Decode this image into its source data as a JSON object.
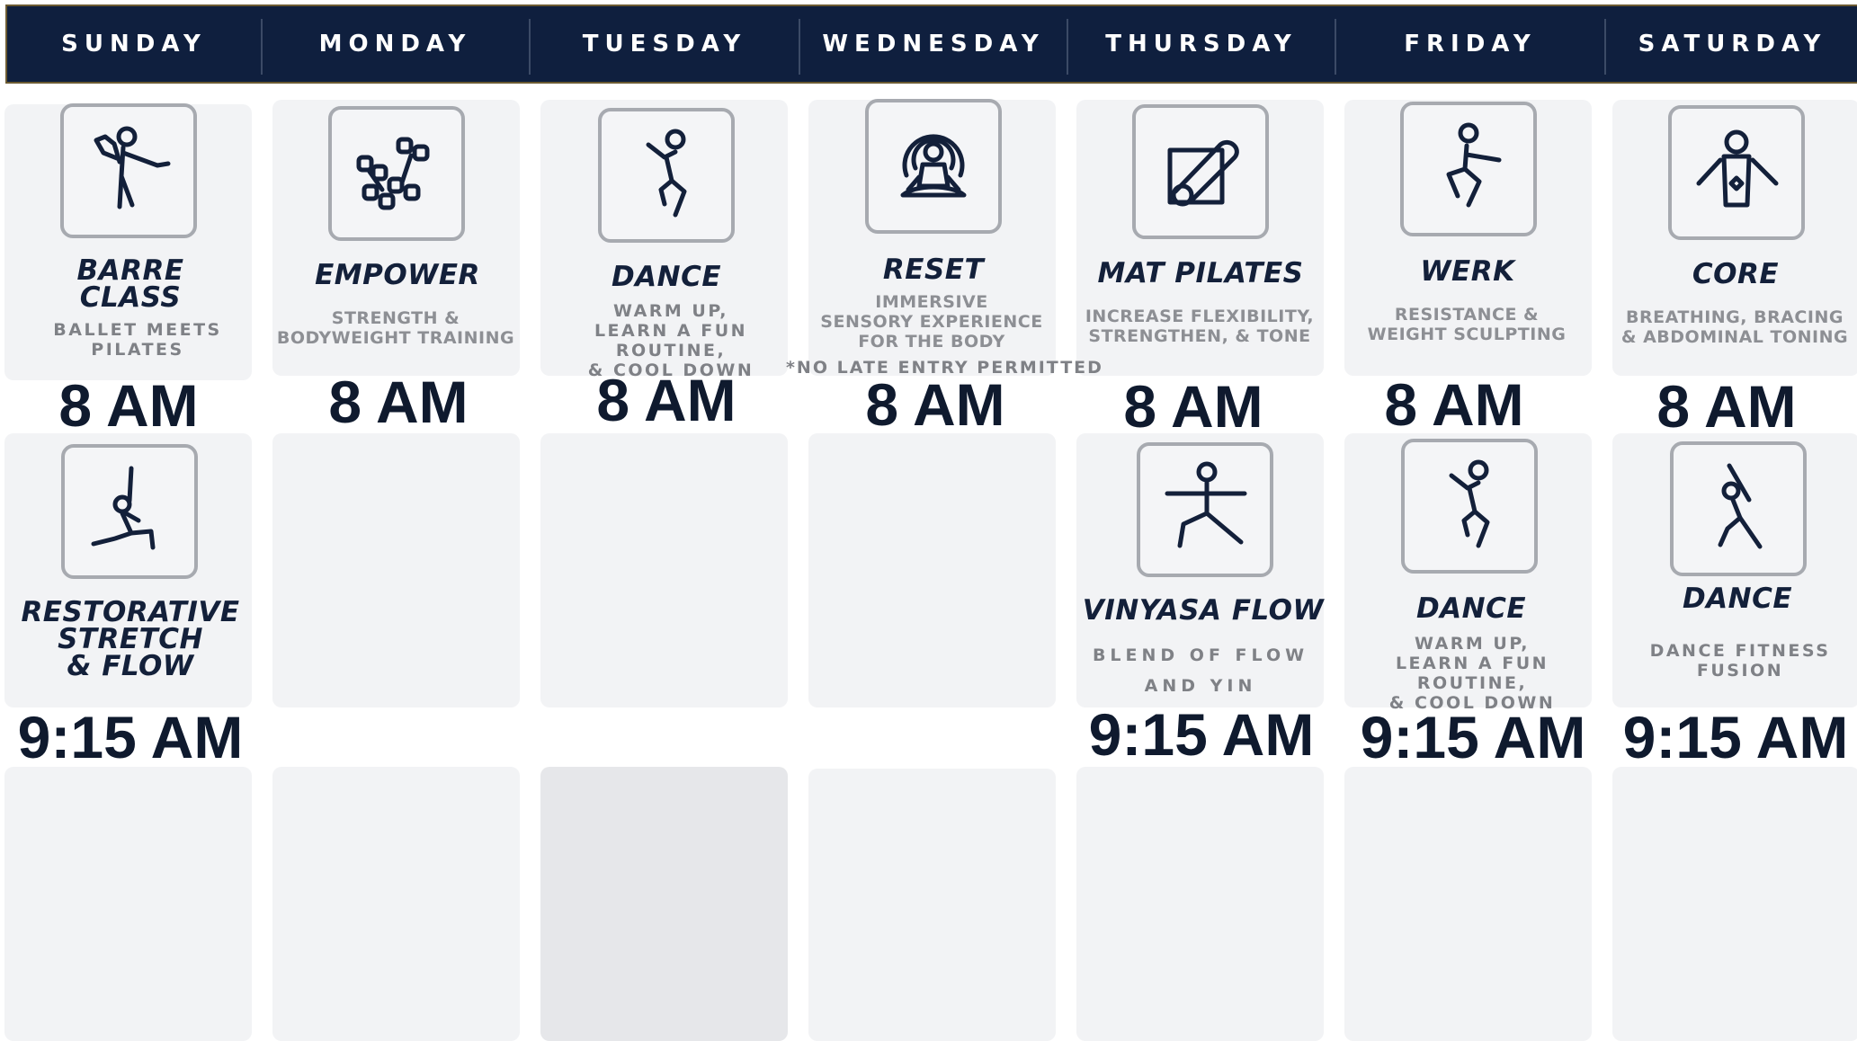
{
  "days": [
    "SUNDAY",
    "MONDAY",
    "TUESDAY",
    "WEDNESDAY",
    "THURSDAY",
    "FRIDAY",
    "SATURDAY"
  ],
  "colors": {
    "header_bg": "#0f1f3e",
    "card_bg": "#f2f3f5",
    "title": "#13203a",
    "subtitle": "#8d8f94"
  },
  "row1": [
    {
      "title": "BARRE\nCLASS",
      "subtitle": "BALLET MEETS\nPILATES",
      "time": "8 AM",
      "icon": "dancer-pose-icon"
    },
    {
      "title": "EMPOWER",
      "subtitle": "STRENGTH &\nBODYWEIGHT TRAINING",
      "time": "8 AM",
      "icon": "dumbbells-icon"
    },
    {
      "title": "DANCE",
      "subtitle": "WARM UP,\nLEARN A FUN ROUTINE,\n& COOL DOWN",
      "time": "8 AM",
      "icon": "dance-leap-icon"
    },
    {
      "title": "RESET",
      "subtitle": "IMMERSIVE\nSENSORY EXPERIENCE\nFOR THE BODY",
      "note": "*NO LATE ENTRY PERMITTED",
      "time": "8 AM",
      "icon": "meditation-icon"
    },
    {
      "title": "MAT PILATES",
      "subtitle": "INCREASE FLEXIBILITY,\nSTRENGTHEN, & TONE",
      "time": "8 AM",
      "icon": "yoga-mat-icon"
    },
    {
      "title": "WERK",
      "subtitle": "RESISTANCE &\nWEIGHT SCULPTING",
      "time": "8 AM",
      "icon": "squat-icon"
    },
    {
      "title": "CORE",
      "subtitle": "BREATHING, BRACING\n& ABDOMINAL TONING",
      "time": "8 AM",
      "icon": "core-torso-icon"
    }
  ],
  "row2": [
    {
      "title": "RESTORATIVE\nSTRETCH\n& FLOW",
      "time": "9:15 AM",
      "icon": "lunge-stretch-icon"
    },
    {},
    {},
    {},
    {
      "title": "VINYASA FLOW",
      "subtitle": "BLEND OF FLOW\nAND YIN",
      "time": "9:15 AM",
      "icon": "warrior-pose-icon"
    },
    {
      "title": "DANCE",
      "subtitle": "WARM UP,\nLEARN A FUN ROUTINE,\n& COOL DOWN",
      "time": "9:15 AM",
      "icon": "dance-leap-icon"
    },
    {
      "title": "DANCE",
      "subtitle": "DANCE FITNESS\nFUSION",
      "time": "9:15 AM",
      "icon": "dance-reach-icon"
    }
  ]
}
